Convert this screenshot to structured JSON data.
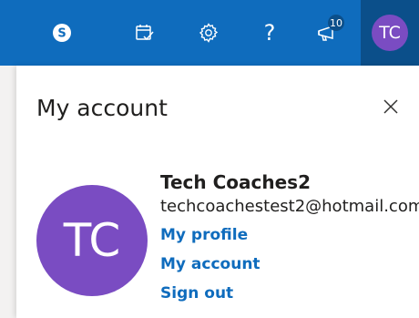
{
  "colors": {
    "header_bg": "#0f6cbd",
    "header_active_bg": "#0b4f8a",
    "avatar_bg": "#7a4cc2",
    "link": "#0f6cbd",
    "text": "#201f1e"
  },
  "header": {
    "icons": [
      "skype-icon",
      "calendar-check-icon",
      "settings-gear-icon",
      "help-icon",
      "megaphone-icon"
    ],
    "help_glyph": "?",
    "notifications_count": "10",
    "avatar_initials": "TC"
  },
  "panel": {
    "title": "My account",
    "close_icon": "close-icon",
    "account": {
      "initials": "TC",
      "name": "Tech Coaches2",
      "email": "techcoachestest2@hotmail.com"
    },
    "links": {
      "my_profile": "My profile",
      "my_account": "My account",
      "sign_out": "Sign out"
    }
  }
}
